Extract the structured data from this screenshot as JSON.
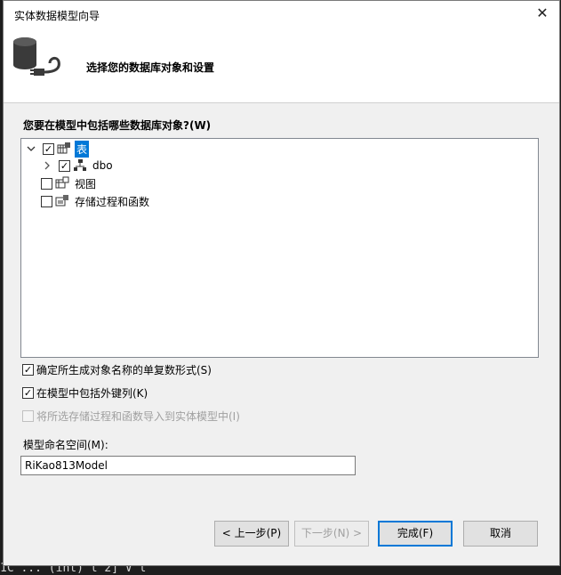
{
  "dialog": {
    "title": "实体数据模型向导",
    "close_glyph": "✕",
    "header_text": "选择您的数据库对象和设置"
  },
  "objects_label": "您要在模型中包括哪些数据库对象?(W)",
  "tree": {
    "items": [
      {
        "label": "表",
        "checked": true,
        "expanded": true,
        "selected": true
      },
      {
        "label": "dbo",
        "checked": true,
        "expanded": false,
        "selected": false
      },
      {
        "label": "视图",
        "checked": false,
        "selected": false
      },
      {
        "label": "存储过程和函数",
        "checked": false,
        "selected": false
      }
    ]
  },
  "options": {
    "pluralize": {
      "label": "确定所生成对象名称的单复数形式(S)",
      "checked": true,
      "enabled": true
    },
    "foreign_keys": {
      "label": "在模型中包括外键列(K)",
      "checked": true,
      "enabled": true
    },
    "import_procs": {
      "label": "将所选存储过程和函数导入到实体模型中(I)",
      "checked": false,
      "enabled": false
    }
  },
  "namespace": {
    "label": "模型命名空间(M):",
    "value": "RiKao813Model"
  },
  "buttons": {
    "back": "< 上一步(P)",
    "next": "下一步(N) >",
    "finish": "完成(F)",
    "cancel": "取消"
  },
  "background_code": "1C  ...  (int) l 2] V l",
  "icons": {
    "close": "close-icon",
    "database": "database-plug-icon",
    "tree_expanded": "chevron-down-icon",
    "tree_collapsed": "chevron-right-icon",
    "table": "table-icon",
    "schema": "schema-icon",
    "view": "view-icon",
    "procedure": "procedure-icon"
  },
  "colors": {
    "selection": "#0078d7",
    "default_button_border": "#0078d7"
  }
}
